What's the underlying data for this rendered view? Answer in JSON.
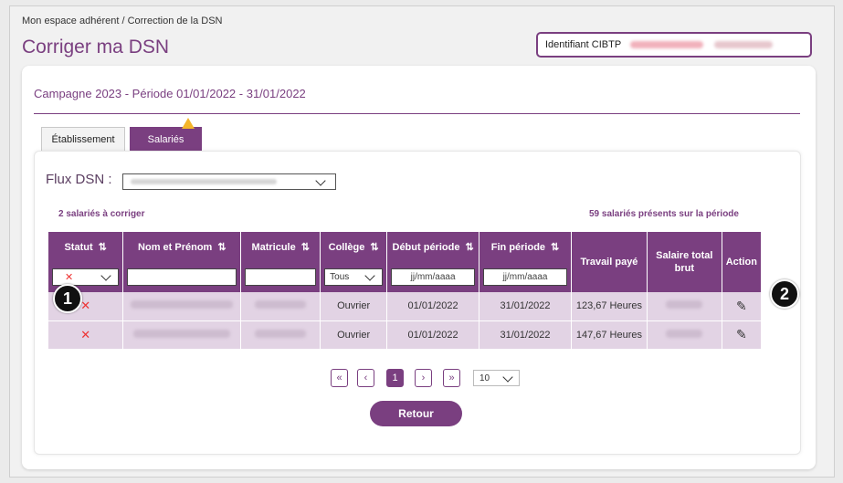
{
  "breadcrumb": "Mon espace adhérent / Correction de la DSN",
  "page_title": "Corriger ma DSN",
  "cibtp_label": "Identifiant CIBTP",
  "campaign": "Campagne 2023 - Période 01/01/2022 - 31/01/2022",
  "tabs": [
    {
      "label": "Établissement"
    },
    {
      "label": "Salariés"
    }
  ],
  "flux_label": "Flux DSN :",
  "count_left": "2 salariés à corriger",
  "count_right": "59 salariés présents sur la période",
  "columns": {
    "statut": "Statut",
    "nom": "Nom et Prénom",
    "matricule": "Matricule",
    "college": "Collège",
    "debut": "Début période",
    "fin": "Fin période",
    "travail": "Travail payé",
    "salaire": "Salaire total brut",
    "action": "Action"
  },
  "sort_glyph": "⇅",
  "filters": {
    "statut_value": "✕",
    "college_value": "Tous",
    "debut_placeholder": "jj/mm/aaaa",
    "fin_placeholder": "jj/mm/aaaa"
  },
  "rows": [
    {
      "statut": "✕",
      "college": "Ouvrier",
      "debut": "01/01/2022",
      "fin": "31/01/2022",
      "travail": "123,67 Heures"
    },
    {
      "statut": "✕",
      "college": "Ouvrier",
      "debut": "01/01/2022",
      "fin": "31/01/2022",
      "travail": "147,67 Heures"
    }
  ],
  "pagination": {
    "first": "«",
    "prev": "‹",
    "current": "1",
    "next": "›",
    "last": "»",
    "page_size": "10"
  },
  "retour_label": "Retour",
  "markers": {
    "one": "1",
    "two": "2"
  },
  "colors": {
    "brand": "#7a3f80",
    "row_bg": "#e2d3e4",
    "status_red": "#e33333",
    "warning": "#f4b52a"
  }
}
